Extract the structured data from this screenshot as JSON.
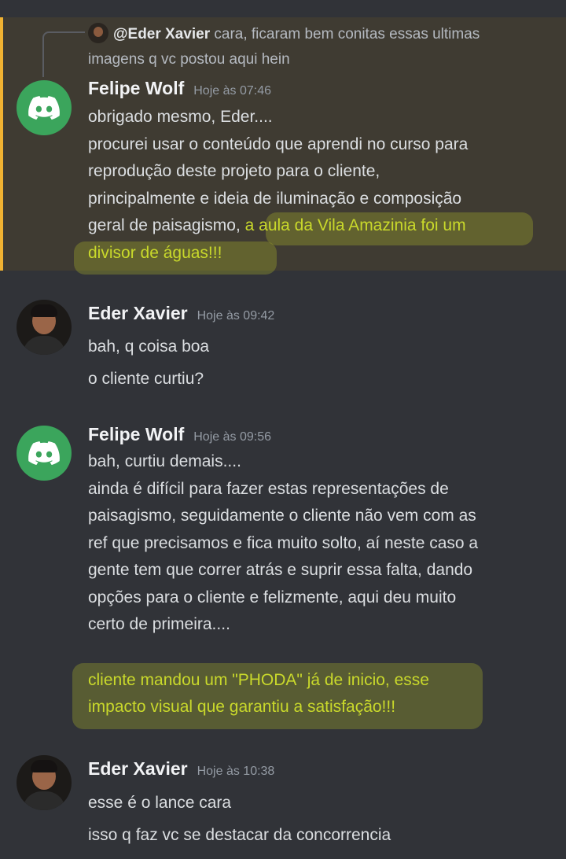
{
  "reply": {
    "mention": "@Eder Xavier",
    "text_first": "cara, ficaram bem conitas essas ultimas",
    "text_second": "imagens q vc postou aqui hein"
  },
  "messages": [
    {
      "author": "Felipe Wolf",
      "time": "Hoje às 07:46",
      "lines": [
        "obrigado mesmo, Eder....",
        "procurei usar o conteúdo que aprendi no curso para",
        "reprodução deste projeto para o cliente,",
        "principalmente e ideia de iluminação e composição"
      ],
      "line5_normal": "geral de paisagismo, ",
      "line5_highlight": "a aula da Vila Amazinia foi um",
      "line6_highlight": "divisor de águas!!!"
    },
    {
      "author": "Eder Xavier",
      "time": "Hoje às 09:42",
      "lines": [
        "bah, q coisa boa",
        "o cliente curtiu?"
      ]
    },
    {
      "author": "Felipe Wolf",
      "time": "Hoje às 09:56",
      "lines": [
        "bah, curtiu demais....",
        "ainda é difícil para fazer estas representações de",
        "paisagismo, seguidamente o cliente não vem com as",
        "ref que precisamos e fica muito solto, aí neste caso a",
        "gente tem que correr atrás e suprir essa falta, dando",
        "opções para o cliente e felizmente, aqui deu muito",
        "certo de primeira...."
      ],
      "highlight_lines": [
        "cliente mandou um \"PHODA\" já de inicio, esse",
        "impacto visual que garantiu a satisfação!!!"
      ]
    },
    {
      "author": "Eder Xavier",
      "time": "Hoje às 10:38",
      "lines": [
        "esse é o lance cara",
        "isso q faz vc se destacar da concorrencia"
      ]
    }
  ]
}
